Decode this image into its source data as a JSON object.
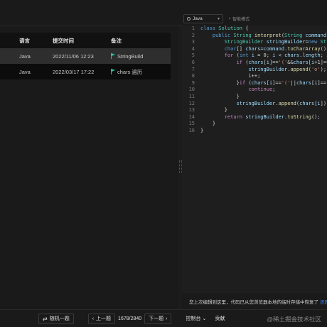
{
  "table": {
    "headers": {
      "lang": "语言",
      "time": "提交时间",
      "note": "备注"
    },
    "rows": [
      {
        "lang": "Java",
        "time": "2022/11/06 12:23",
        "note": "StringBuild"
      },
      {
        "lang": "Java",
        "time": "2022/03/17 17:22",
        "note": "chars 遍历"
      }
    ]
  },
  "editor": {
    "language": "Java",
    "smart_mode": "智能模式",
    "line_numbers": [
      "1",
      "2",
      "3",
      "4",
      "5",
      "6",
      "7",
      "8",
      "9",
      "10",
      "11",
      "12",
      "13",
      "14",
      "15",
      "16"
    ]
  },
  "notice": {
    "text": "您上次编辑到这里，代码已从您浏览器本地的临时存储中恢复了",
    "link": "还原默认"
  },
  "bottom": {
    "random": "随机一题",
    "prev": "上一题",
    "page": "1678/2840",
    "next": "下一题",
    "console": "控制台",
    "contribute": "贡献"
  },
  "watermark": "@稀土掘金技术社区",
  "colors": {
    "accent": "#2cbb9a",
    "link": "#3b82f6",
    "background": "#1a1a1a"
  }
}
